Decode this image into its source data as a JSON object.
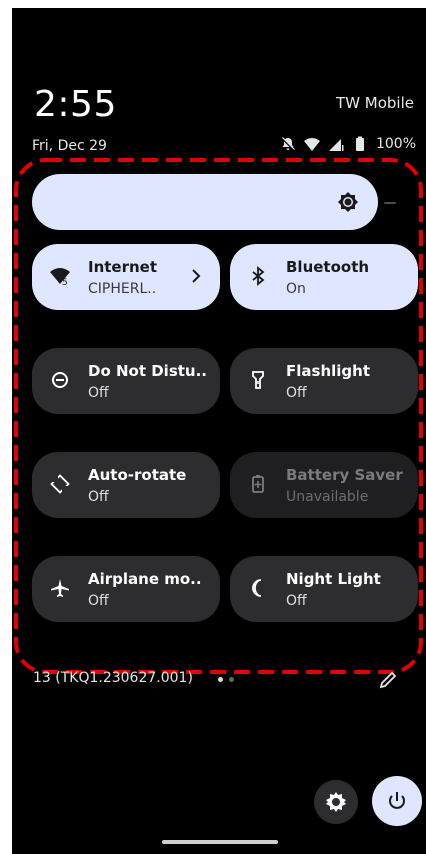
{
  "header": {
    "time": "2:55",
    "carrier": "TW Mobile",
    "date": "Fri, Dec 29",
    "battery_text": "100%"
  },
  "brightness": {
    "icon": "brightness-icon"
  },
  "tiles": [
    {
      "title": "Internet",
      "subtitle": "CIPHERL..",
      "state": "on",
      "icon": "wifi-icon",
      "has_chevron": true
    },
    {
      "title": "Bluetooth",
      "subtitle": "On",
      "state": "on",
      "icon": "bluetooth-icon"
    },
    {
      "title": "Do Not Distu..",
      "subtitle": "Off",
      "state": "off",
      "icon": "do-not-disturb-icon"
    },
    {
      "title": "Flashlight",
      "subtitle": "Off",
      "state": "off",
      "icon": "flashlight-icon"
    },
    {
      "title": "Auto-rotate",
      "subtitle": "Off",
      "state": "off",
      "icon": "auto-rotate-icon"
    },
    {
      "title": "Battery Saver",
      "subtitle": "Unavailable",
      "state": "unavailable",
      "icon": "battery-saver-icon"
    },
    {
      "title": "Airplane mo..",
      "subtitle": "Off",
      "state": "off",
      "icon": "airplane-icon"
    },
    {
      "title": "Night Light",
      "subtitle": "Off",
      "state": "off",
      "icon": "night-light-icon"
    }
  ],
  "footer": {
    "build": "13 (TKQ1.230627.001)",
    "page_index": 1,
    "page_count": 2
  },
  "colors": {
    "tile_on": "#dfe6ff",
    "tile_off": "#2d2d30",
    "annotation": "#e00000"
  }
}
